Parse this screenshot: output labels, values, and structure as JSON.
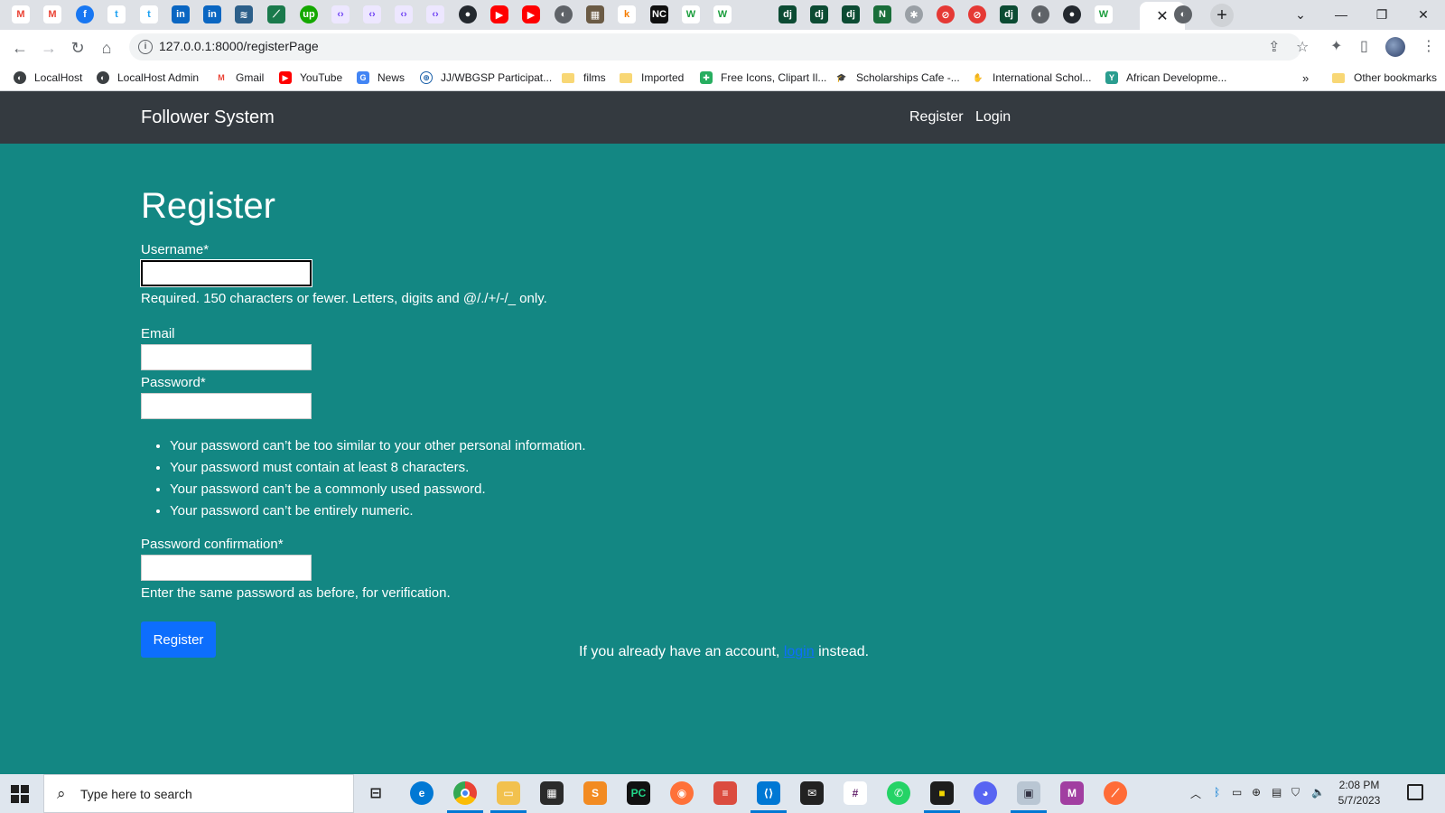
{
  "browser": {
    "url": "127.0.0.1:8000/registerPage",
    "active_tab_close": "✕",
    "new_tab": "+",
    "bookmarks": [
      {
        "label": "LocalHost",
        "icon": "globe-icon"
      },
      {
        "label": "LocalHost Admin",
        "icon": "globe-icon"
      },
      {
        "label": "Gmail",
        "icon": "gmail-icon"
      },
      {
        "label": "YouTube",
        "icon": "youtube-icon"
      },
      {
        "label": "News",
        "icon": "news-icon"
      },
      {
        "label": "JJ/WBGSP Participat...",
        "icon": "scholarship-icon"
      },
      {
        "label": "films",
        "icon": "folder-icon"
      },
      {
        "label": "Imported",
        "icon": "folder-icon"
      },
      {
        "label": "Free Icons, Clipart Il...",
        "icon": "icons-icon"
      },
      {
        "label": "Scholarships Cafe -...",
        "icon": "cap-icon"
      },
      {
        "label": "International Schol...",
        "icon": "hand-icon"
      },
      {
        "label": "African Developme...",
        "icon": "afdb-icon"
      }
    ],
    "bookmarks_overflow": "»",
    "other_bookmarks": "Other bookmarks"
  },
  "navbar": {
    "brand": "Follower System",
    "links": [
      "Register",
      "Login"
    ]
  },
  "form": {
    "title": "Register",
    "username_label": "Username*",
    "username_help": "Required. 150 characters or fewer. Letters, digits and @/./+/-/_ only.",
    "email_label": "Email",
    "password_label": "Password*",
    "password_rules": [
      "Your password can’t be too similar to your other personal information.",
      "Your password must contain at least 8 characters.",
      "Your password can’t be a commonly used password.",
      "Your password can’t be entirely numeric."
    ],
    "confirm_label": "Password confirmation*",
    "confirm_help": "Enter the same password as before, for verification.",
    "submit_label": "Register",
    "footer_prefix": "If you already have an account, ",
    "footer_link": "login",
    "footer_suffix": " instead."
  },
  "taskbar": {
    "search_placeholder": "Type here to search",
    "time": "2:08 PM",
    "date": "5/7/2023"
  }
}
